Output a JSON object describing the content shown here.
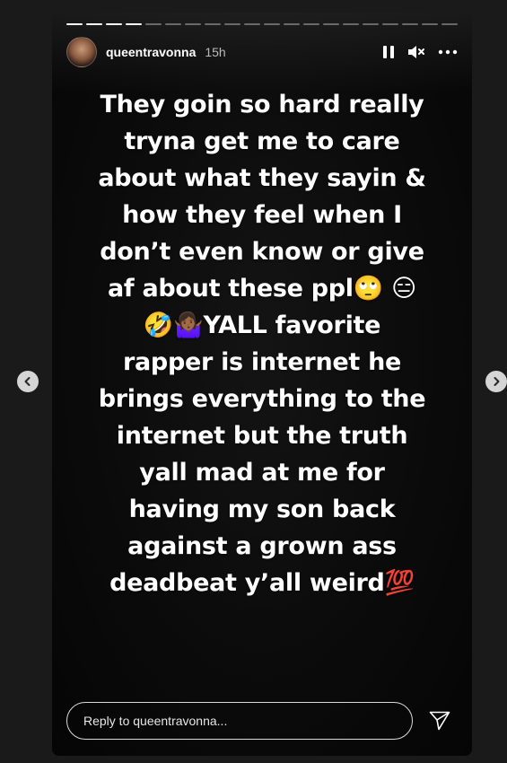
{
  "story": {
    "username": "queentravonna",
    "time": "15h",
    "segments_total": 20,
    "segments_done": 4,
    "text_lines": [
      "They goin so hard really",
      "tryna get me to care",
      "about what they sayin &",
      "how they feel when I",
      "don’t even know or give",
      "af about these ppl🙄 😑",
      "🤣🤷🏾‍♀️YALL favorite",
      "rapper is internet he",
      "brings everything to the",
      "internet but the truth",
      "yall mad at me for",
      "having my son back",
      "against a grown ass",
      "deadbeat y’all weird💯"
    ]
  },
  "reply": {
    "placeholder": "Reply to queentravonna..."
  },
  "icons": {
    "pause": "pause-icon",
    "mute": "speaker-muted-icon",
    "more": "more-options-icon",
    "send": "send-icon",
    "prev": "chevron-left-icon",
    "next": "chevron-right-icon"
  }
}
